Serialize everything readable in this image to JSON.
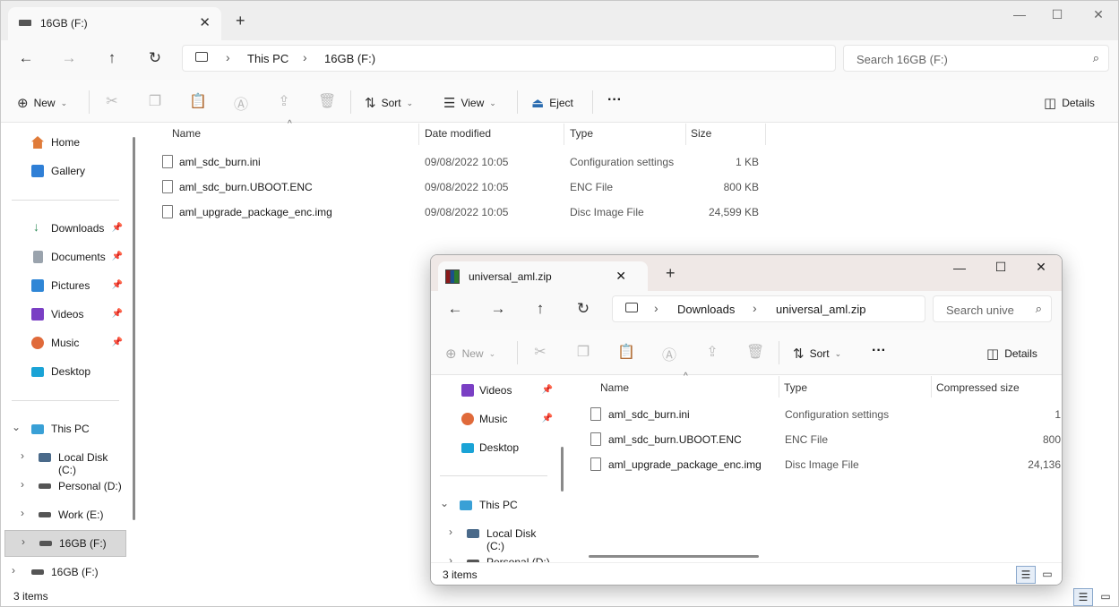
{
  "main": {
    "tab_title": "16GB (F:)",
    "breadcrumb": [
      "This PC",
      "16GB (F:)"
    ],
    "search_placeholder": "Search 16GB (F:)",
    "cmd": {
      "new": "New",
      "sort": "Sort",
      "view": "View",
      "eject": "Eject",
      "details": "Details"
    },
    "sidebar": {
      "home": "Home",
      "gallery": "Gallery",
      "downloads": "Downloads",
      "documents": "Documents",
      "pictures": "Pictures",
      "videos": "Videos",
      "music": "Music",
      "desktop": "Desktop",
      "this_pc": "This PC",
      "local_c": "Local Disk (C:)",
      "personal_d": "Personal (D:)",
      "work_e": "Work (E:)",
      "drive_f": "16GB (F:)",
      "drive_f2": "16GB (F:)"
    },
    "columns": {
      "name": "Name",
      "date": "Date modified",
      "type": "Type",
      "size": "Size"
    },
    "files": [
      {
        "name": "aml_sdc_burn.ini",
        "date": "09/08/2022 10:05",
        "type": "Configuration settings",
        "size": "1 KB"
      },
      {
        "name": "aml_sdc_burn.UBOOT.ENC",
        "date": "09/08/2022 10:05",
        "type": "ENC File",
        "size": "800 KB"
      },
      {
        "name": "aml_upgrade_package_enc.img",
        "date": "09/08/2022 10:05",
        "type": "Disc Image File",
        "size": "24,599 KB"
      }
    ],
    "status": "3 items"
  },
  "zipwin": {
    "tab_title": "universal_aml.zip",
    "breadcrumb": [
      "Downloads",
      "universal_aml.zip"
    ],
    "search_placeholder": "Search unive",
    "cmd": {
      "new": "New",
      "sort": "Sort",
      "details": "Details"
    },
    "sidebar": {
      "videos": "Videos",
      "music": "Music",
      "desktop": "Desktop",
      "this_pc": "This PC",
      "local_c": "Local Disk (C:)",
      "personal_d": "Personal (D:)"
    },
    "columns": {
      "name": "Name",
      "type": "Type",
      "compressed": "Compressed size"
    },
    "files": [
      {
        "name": "aml_sdc_burn.ini",
        "type": "Configuration settings",
        "size": "1"
      },
      {
        "name": "aml_sdc_burn.UBOOT.ENC",
        "type": "ENC File",
        "size": "800"
      },
      {
        "name": "aml_upgrade_package_enc.img",
        "type": "Disc Image File",
        "size": "24,136"
      }
    ],
    "status": "3 items"
  }
}
